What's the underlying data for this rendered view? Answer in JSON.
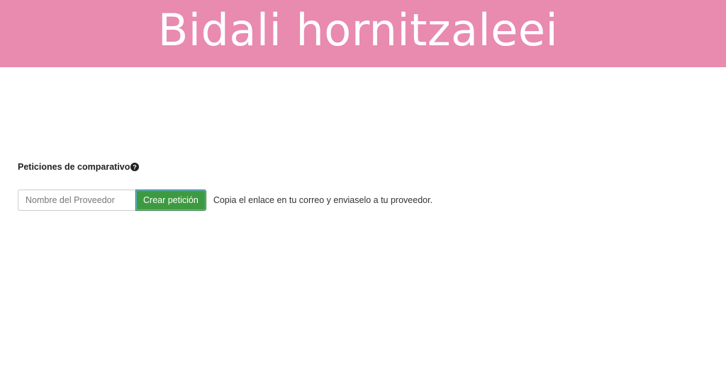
{
  "banner": {
    "title": "Bidali hornitzaleei",
    "background": "#e98aaf"
  },
  "section": {
    "title": "Peticiones de comparativo",
    "help_icon": "question-circle-icon"
  },
  "form": {
    "vendor_placeholder": "Nombre del Proveedor",
    "vendor_value": "",
    "create_button_label": "Crear petición",
    "hint": "Copia el enlace en tu correo y enviaselo a tu proveedor.",
    "button_color": "#3e9a41"
  }
}
